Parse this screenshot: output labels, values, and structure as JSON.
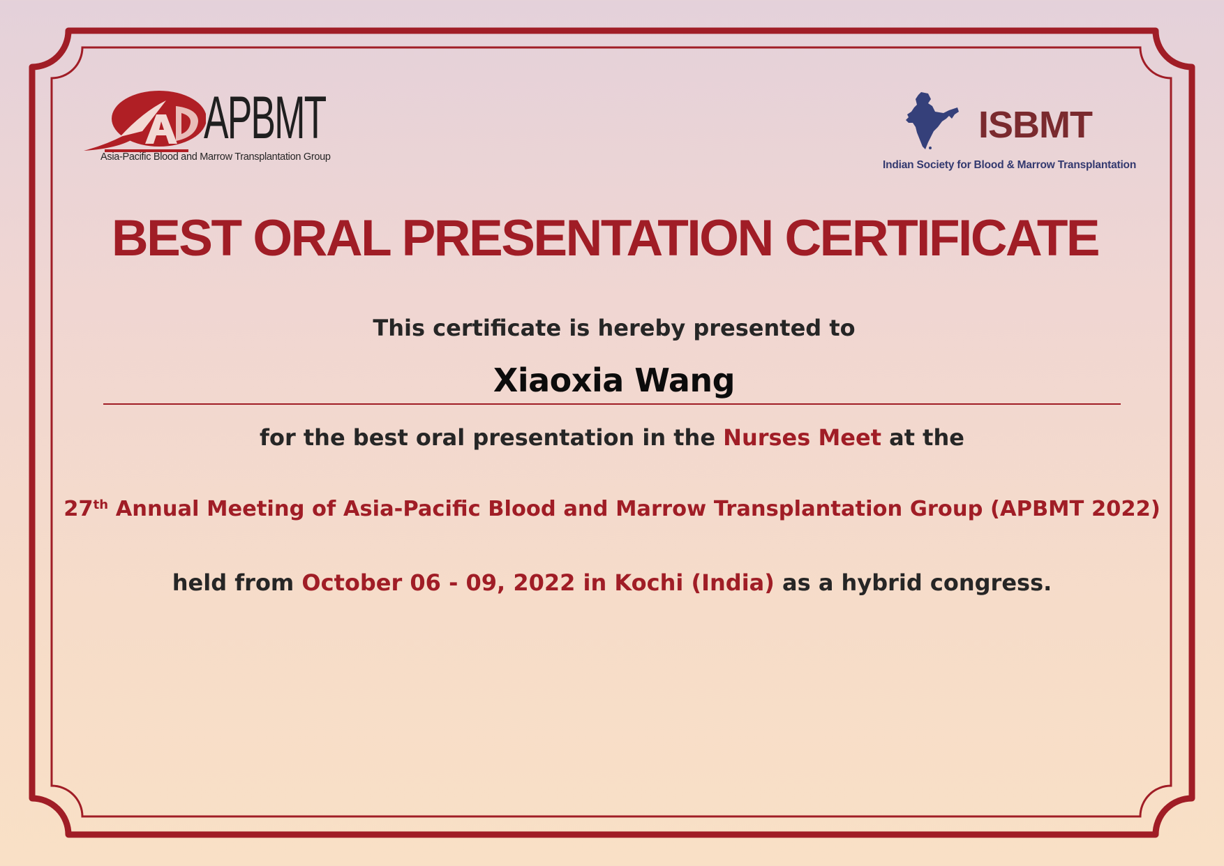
{
  "logos": {
    "apbmt": {
      "wordmark": "APBMT",
      "subtitle": "Asia-Pacific Blood and Marrow Transplantation Group",
      "icon": "apbmt-swoosh-emblem-icon"
    },
    "isbmt": {
      "wordmark": "ISBMT",
      "subtitle": "Indian Society for Blood & Marrow Transplantation",
      "icon": "india-map-icon"
    }
  },
  "certificate": {
    "title": "BEST ORAL PRESENTATION CERTIFICATE",
    "presented_to": "This certificate is hereby presented to",
    "recipient_name": "Xiaoxia Wang",
    "reason": {
      "prefix": "for the best oral presentation in the ",
      "event": "Nurses Meet",
      "suffix": " at the"
    },
    "meeting": {
      "number": "27",
      "ordinal_suffix": "th",
      "name": " Annual Meeting of Asia-Pacific Blood and Marrow Transplantation Group (APBMT 2022)"
    },
    "held": {
      "prefix": "held from ",
      "dates_location": "October 06 - 09, 2022 in Kochi (India)",
      "suffix": " as a hybrid congress."
    }
  },
  "colors": {
    "accent": "#a01d26",
    "text": "#262626",
    "isbmt_brown": "#7a2a2e",
    "isbmt_blue": "#33396f"
  }
}
